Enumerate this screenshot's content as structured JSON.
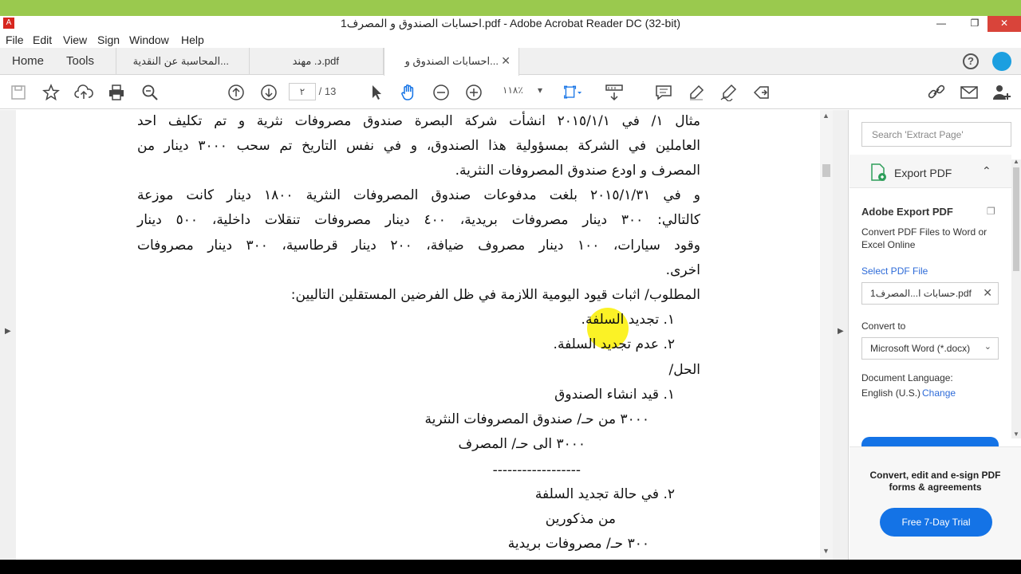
{
  "window": {
    "title": "احسابات الصندوق و المصرف1.pdf - Adobe Acrobat Reader DC (32-bit)",
    "icon_text": "A"
  },
  "menu": [
    "File",
    "Edit",
    "View",
    "Sign",
    "Window",
    "Help"
  ],
  "nav": {
    "home": "Home",
    "tools": "Tools"
  },
  "tabs": [
    {
      "label": "المحاسبة عن النقدية..."
    },
    {
      "label": "د. مهند.pdf"
    },
    {
      "label": "احسابات الصندوق و..."
    }
  ],
  "toolbar": {
    "page_current": "٢",
    "page_sep": "/",
    "page_total": "13",
    "zoom": "١١٨٪"
  },
  "document": {
    "lines": [
      "مثال ١/ في ٢٠١٥/١/١ انشأت شركة البصرة صندوق مصروفات نثرية و تم تكليف احد",
      "العاملين في الشركة بمسؤولية هذا الصندوق، و في نفس التاريخ تم سحب ٣٠٠٠ دينار من",
      "المصرف و اودع صندوق المصروفات النثرية.",
      "و في ٢٠١٥/١/٣١ بلغت مدفوعات صندوق المصروفات النثرية ١٨٠٠ دينار كانت موزعة",
      "كالتالي: ٣٠٠ دينار مصروفات بريدية، ٤٠٠ دينار مصروفات تنقلات داخلية، ٥٠٠ دينار",
      "وقود سيارات، ١٠٠ دينار مصروف ضيافة، ٢٠٠ دينار قرطاسية، ٣٠٠ دينار مصروفات",
      "اخرى.",
      "المطلوب/ اثبات قيود اليومية اللازمة في ظل الفرضين المستقلين التاليين:",
      "١.  تجديد السلفة.",
      "٢.  عدم تجديد السلفة.",
      "الحل/",
      "١.  قيد انشاء الصندوق",
      "٣٠٠٠ من حـ/ صندوق المصروفات النثرية",
      "٣٠٠٠ الى حـ/ المصرف",
      "------------------",
      "٢.  في حالة تجديد السلفة",
      "من مذكورين",
      "٣٠٠ حـ/ مصروفات بريدية"
    ]
  },
  "right_panel": {
    "search_placeholder": "Search 'Extract Page'",
    "export_title": "Export PDF",
    "adobe_export_title": "Adobe Export PDF",
    "adobe_export_desc": "Convert PDF Files to Word or Excel Online",
    "select_pdf_label": "Select PDF File",
    "selected_file": "حسابات ا...المصرف1.pdf",
    "convert_to_label": "Convert to",
    "convert_to_value": "Microsoft Word (*.docx)",
    "doc_lang_label": "Document Language:",
    "doc_lang_value": "English (U.S.)",
    "change_link": "Change",
    "promo_text": "Convert, edit and e-sign PDF forms & agreements",
    "trial_button": "Free 7-Day Trial"
  }
}
